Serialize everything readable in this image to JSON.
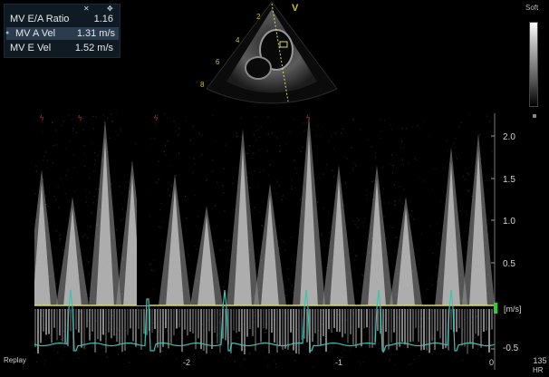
{
  "measurements": {
    "header_icons": [
      "clear-icon",
      "move-icon"
    ],
    "rows": [
      {
        "label": "MV E/A Ratio",
        "value": "1.16",
        "selected": false
      },
      {
        "label": "MV A Vel",
        "value": "1.31 m/s",
        "selected": true
      },
      {
        "label": "MV E Vel",
        "value": "1.52 m/s",
        "selected": false
      }
    ]
  },
  "sector": {
    "probe_marker": "V",
    "depth_marks": [
      "2",
      "4",
      "6",
      "8"
    ]
  },
  "grayscale": {
    "label": "Soft"
  },
  "doppler": {
    "scale_labels": [
      "2.0",
      "1.5",
      "1.0",
      "0.5",
      "-0.5"
    ],
    "unit": "[m/s]",
    "time_labels": [
      "-2",
      "-1",
      "0"
    ],
    "replay_label": "Replay",
    "heart_rate": "135",
    "hr_label": "HR",
    "baseline_color": "#d8d86a",
    "ecg_color": "#3fc0b4",
    "marker_color": "#27d13a"
  }
}
